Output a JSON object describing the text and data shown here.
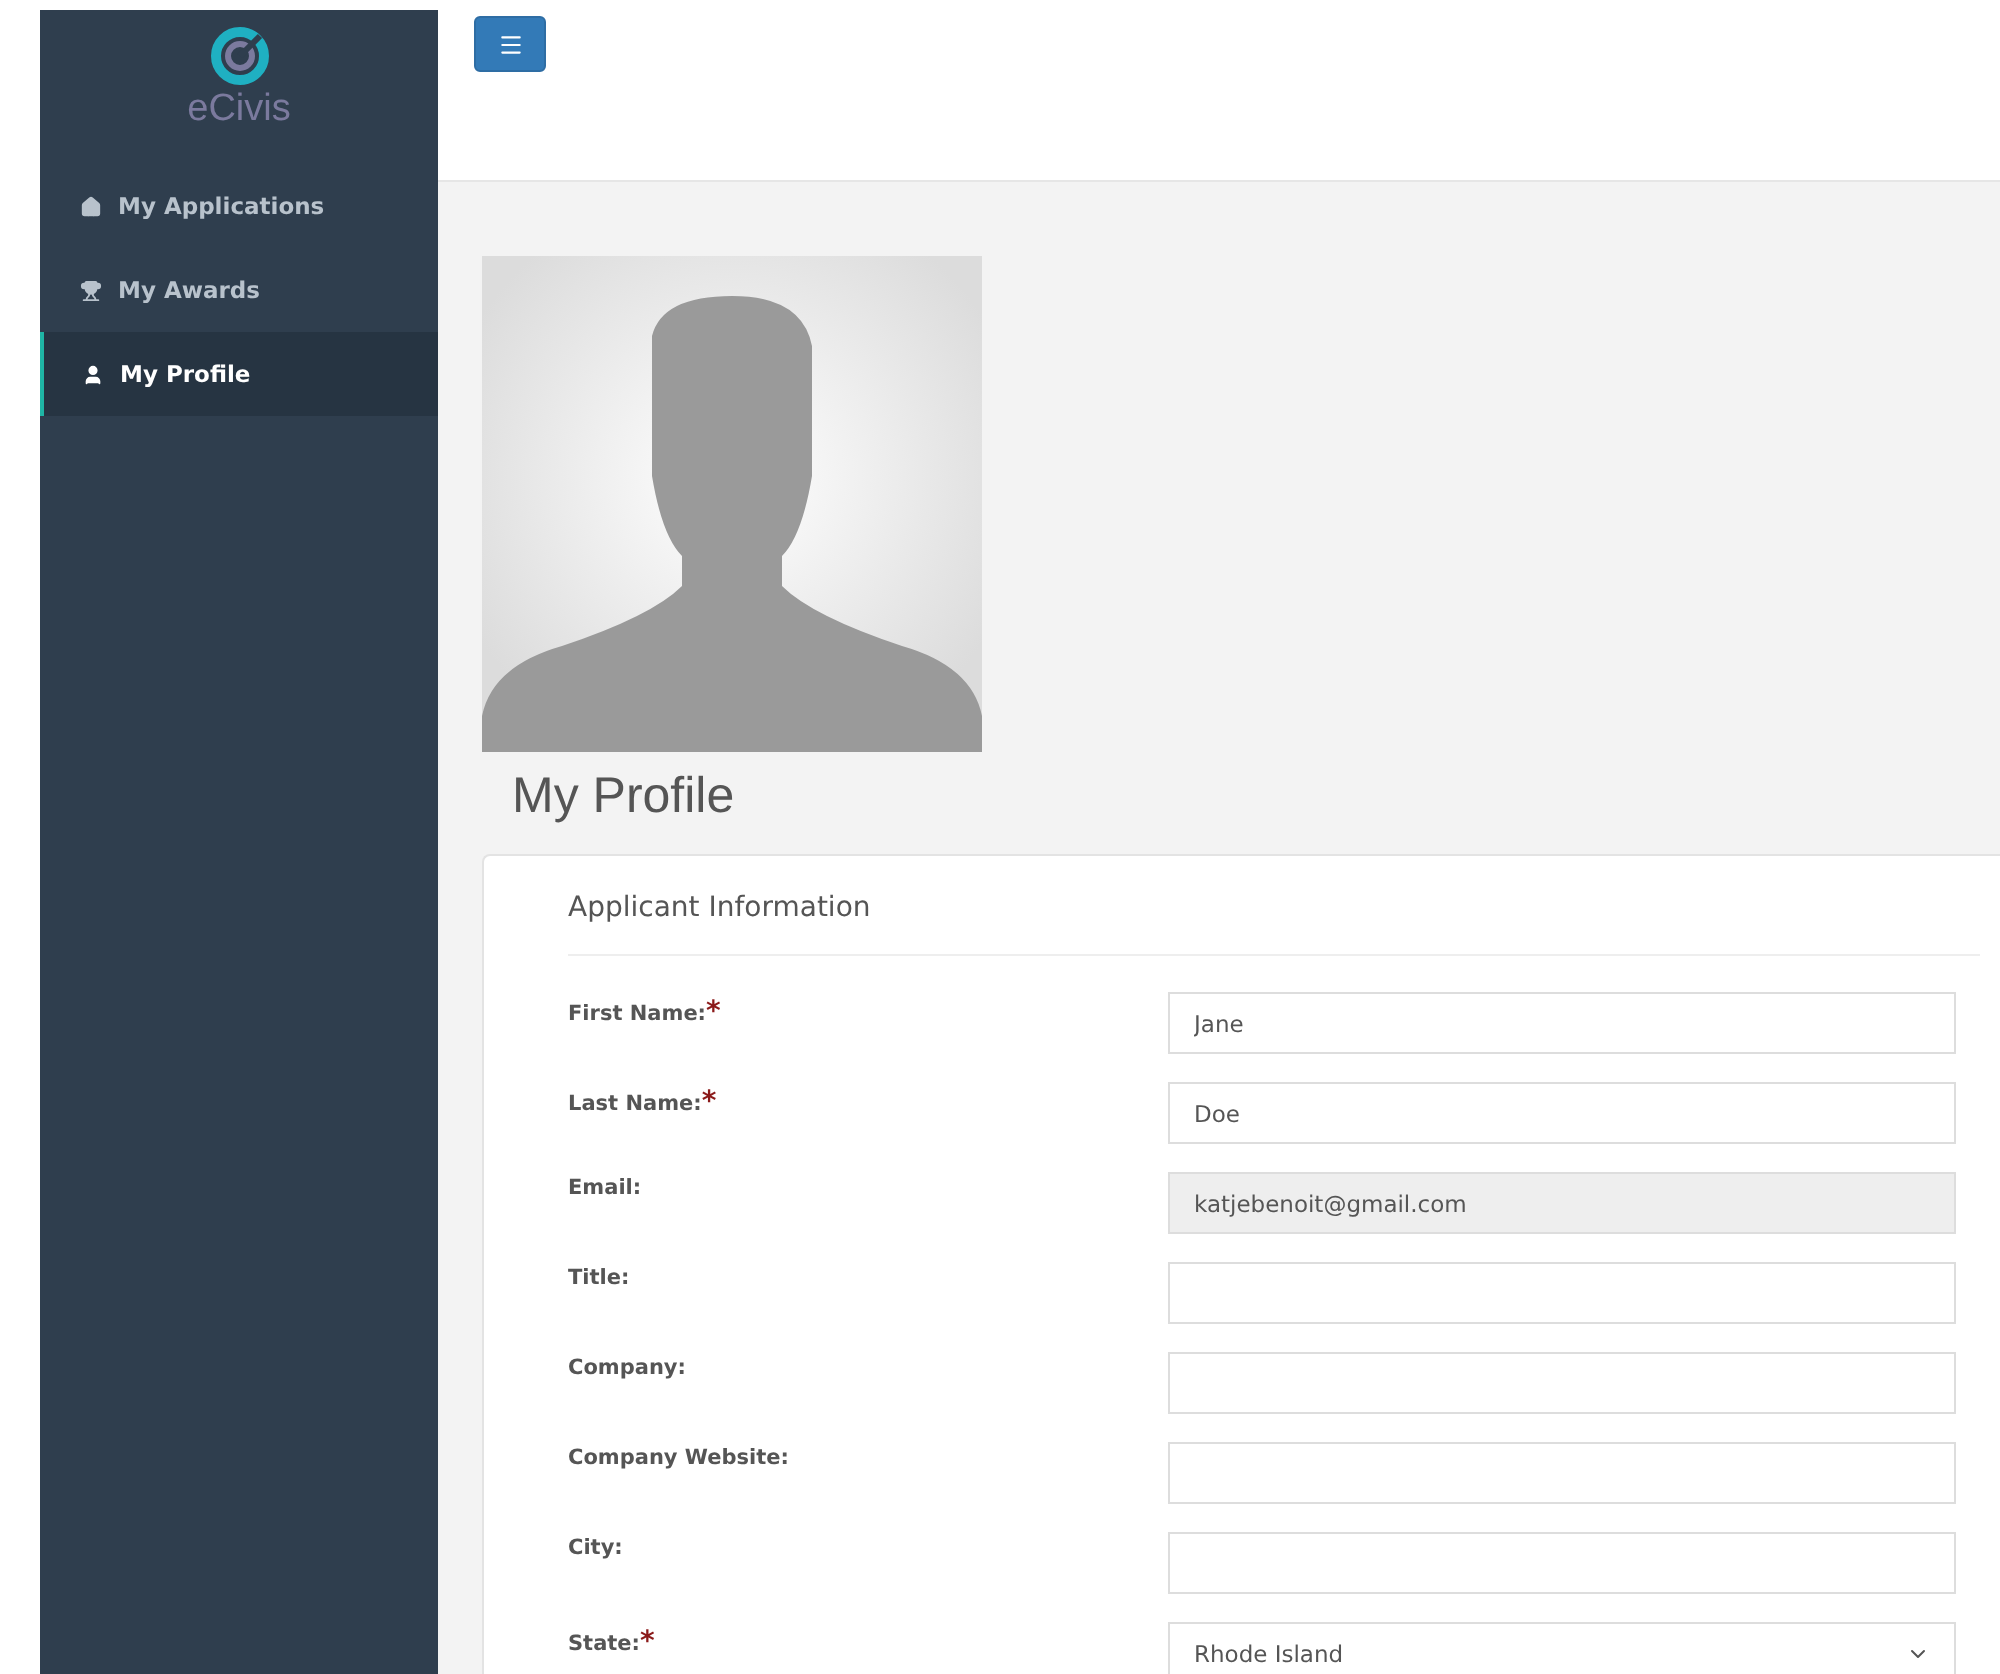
{
  "brand": {
    "name": "eCivis"
  },
  "sidebar": {
    "items": [
      {
        "label": "My Applications",
        "selected": false
      },
      {
        "label": "My Awards",
        "selected": false
      },
      {
        "label": "My Profile",
        "selected": true
      }
    ]
  },
  "page": {
    "title": "My Profile"
  },
  "section": {
    "title": "Applicant Information",
    "required_mark": "*",
    "fields": [
      {
        "kind": "text",
        "label": "First Name:",
        "required": true,
        "disabled": false,
        "value": "Jane"
      },
      {
        "kind": "text",
        "label": "Last Name:",
        "required": true,
        "disabled": false,
        "value": "Doe"
      },
      {
        "kind": "text",
        "label": "Email:",
        "required": false,
        "disabled": true,
        "value": "katjebenoit@gmail.com"
      },
      {
        "kind": "text",
        "label": "Title:",
        "required": false,
        "disabled": false
      },
      {
        "kind": "text",
        "label": "Company:",
        "required": false,
        "disabled": false
      },
      {
        "kind": "text",
        "label": "Company Website:",
        "required": false,
        "disabled": false
      },
      {
        "kind": "text",
        "label": "City:",
        "required": false,
        "disabled": false
      },
      {
        "kind": "select",
        "label": "State:",
        "required": true,
        "disabled": false,
        "value": "Rhode Island"
      }
    ]
  }
}
